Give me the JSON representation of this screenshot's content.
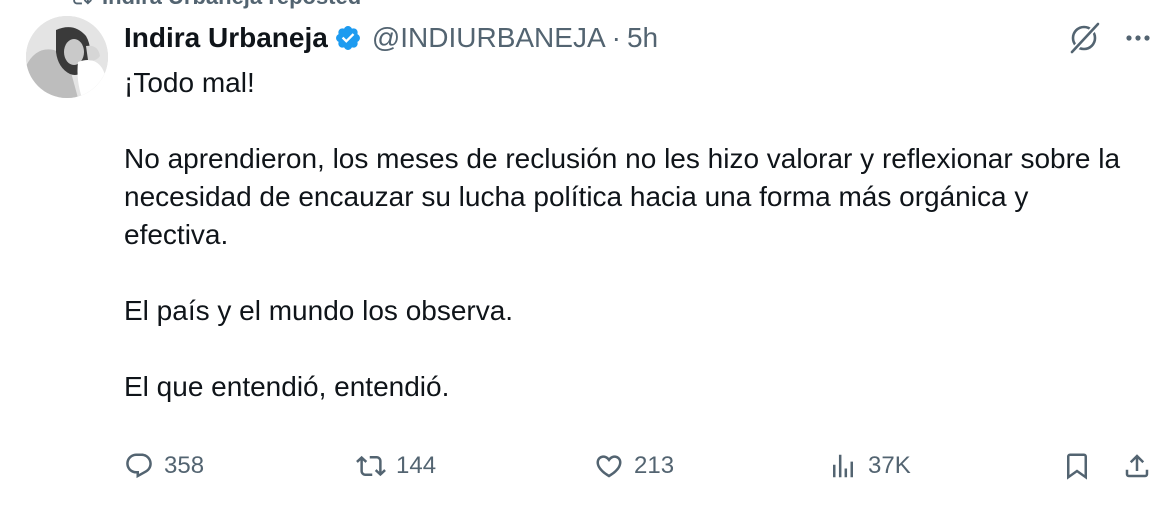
{
  "repost": {
    "text": "Indira Urbaneja reposted"
  },
  "author": {
    "name": "Indira Urbaneja",
    "handle": "@INDIURBANEJA",
    "separator": "·",
    "time": "5h",
    "verified": true
  },
  "icons": {
    "avatar": "avatar-photo",
    "verified": "verified-badge-icon",
    "grok": "grok-icon",
    "more": "more-icon",
    "reply": "reply-icon",
    "retweet": "retweet-icon",
    "like": "like-icon",
    "views": "views-icon",
    "bookmark": "bookmark-icon",
    "share": "share-icon"
  },
  "tweet": {
    "paragraphs": [
      "¡Todo mal!",
      "No aprendieron, los meses de reclusión no les hizo valorar y reflexionar sobre la necesidad de encauzar su lucha política hacia una forma más orgánica y efectiva.",
      "El país y el mundo los observa.",
      "El que entendió, entendió."
    ]
  },
  "metrics": {
    "replies": "358",
    "retweets": "144",
    "likes": "213",
    "views": "37K"
  },
  "colors": {
    "text": "#0f1419",
    "secondary": "#536471",
    "verified": "#1d9bf0"
  }
}
